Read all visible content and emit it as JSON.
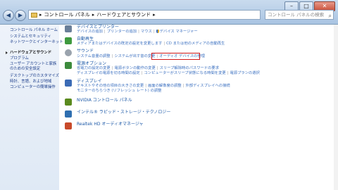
{
  "window": {
    "min": "–",
    "max": "□",
    "close": "✕"
  },
  "address": {
    "segments": [
      "コントロール パネル",
      "ハードウェアとサウンド"
    ],
    "sep": "▸"
  },
  "search": {
    "placeholder": "コントロール パネルの検索"
  },
  "sidebar": [
    "コントロール パネル ホーム",
    "システムとセキュリティ",
    "ネットワークとインターネット",
    "ハードウェアとサウンド",
    "プログラム",
    "ユーザー アカウントと家族のための安全設定",
    "デスクトップのカスタマイズ",
    "時計、言語、および地域",
    "コンピューターの簡単操作"
  ],
  "categories": [
    {
      "title": "デバイスとプリンター",
      "links": [
        "デバイスの追加",
        "プリンターの追加",
        "マウス",
        "デバイス マネージャー"
      ],
      "color": "#6a7f99"
    },
    {
      "title": "自動再生",
      "links": [
        "メディアまたはデバイスの既定の設定を変更します",
        "CD または他のメディアの自動再生"
      ],
      "color": "#3f9a3f"
    },
    {
      "title": "サウンド",
      "links": [
        "システム音量の調整",
        "システムが出す音の変更",
        "オーディオ デバイスの管理"
      ],
      "color": "#9aa3ad"
    },
    {
      "title": "電源オプション",
      "links": [
        "省電力の設定の変更",
        "電源ボタンの動作の変更",
        "スリープ解除時のパスワードの要求",
        "ディスプレイの電源を切る時間の設定",
        "コンピューターがスリープ状態になる時間を変更",
        "電源プランの選択"
      ],
      "color": "#3c8a3c"
    },
    {
      "title": "ディスプレイ",
      "links": [
        "テキストやその他の項目の大きさの変更",
        "画面の解像度の調整",
        "外部ディスプレイへの接続",
        "モニターのちらつき (リフレッシュ レート) の調整"
      ],
      "color": "#3b6bb5"
    },
    {
      "title": "NVIDIA コントロール パネル",
      "links": [],
      "color": "#5a8a1e"
    },
    {
      "title": "インテル® ラピッド・ストレージ・テクノロジー",
      "links": [],
      "color": "#2f6fb0"
    },
    {
      "title": "Realtek HD オーディオマネージャ",
      "links": [],
      "color": "#c84a2a"
    }
  ]
}
